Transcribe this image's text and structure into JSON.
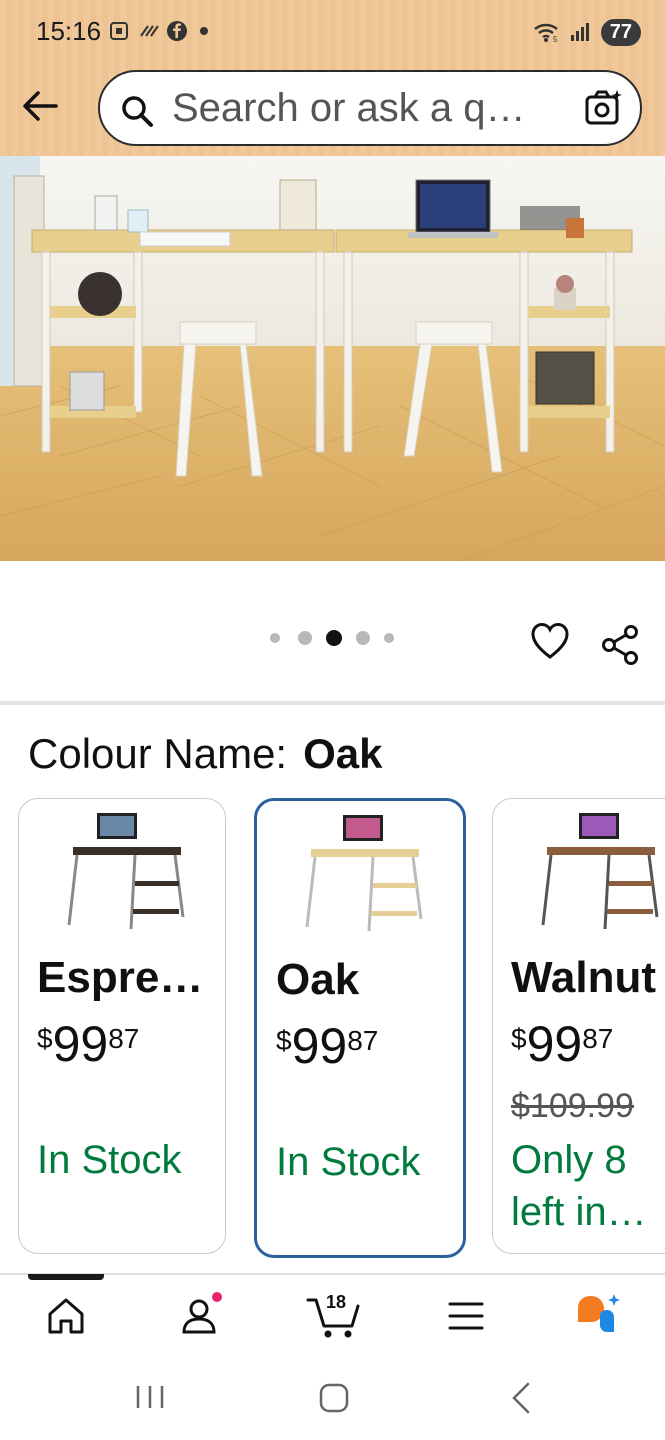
{
  "status_bar": {
    "time": "15:16",
    "battery": "77",
    "icons": [
      "screenshot-icon",
      "nfc-icon",
      "facebook-icon",
      "dot-icon",
      "wifi-icon",
      "signal-icon"
    ]
  },
  "header": {
    "back_icon": "back-arrow-icon",
    "search_placeholder": "Search or ask a q…",
    "camera_icon": "camera-search-icon"
  },
  "gallery": {
    "dot_count": 5,
    "active_dot": 3,
    "icons": [
      "heart-icon",
      "share-icon"
    ]
  },
  "variation": {
    "label": "Colour Name:",
    "selected": "Oak",
    "options": [
      {
        "name": "Espre…",
        "price_symbol": "$",
        "price_whole": "99",
        "price_fraction": "87",
        "list_price": "",
        "stock_line1": "In Stock",
        "stock_line2": "",
        "selected": false
      },
      {
        "name": "Oak",
        "price_symbol": "$",
        "price_whole": "99",
        "price_fraction": "87",
        "list_price": "",
        "stock_line1": "In Stock",
        "stock_line2": "",
        "selected": true
      },
      {
        "name": "Walnut",
        "price_symbol": "$",
        "price_whole": "99",
        "price_fraction": "87",
        "list_price": "$109.99",
        "stock_line1": "Only 8",
        "stock_line2": "left in…",
        "selected": false
      }
    ]
  },
  "bottom_nav": {
    "items": [
      "home-icon",
      "account-icon",
      "cart-icon",
      "menu-icon",
      "rufus-icon"
    ],
    "cart_count": "18"
  },
  "system_nav": [
    "recents-icon",
    "home-button-icon",
    "back-icon"
  ],
  "colors": {
    "header_bg": "#f0c89a",
    "selected_border": "#2b6198",
    "stock_green": "#007a3d",
    "notification_dot": "#e8246e",
    "rufus_orange": "#f47c20",
    "rufus_blue": "#1e88e5"
  }
}
